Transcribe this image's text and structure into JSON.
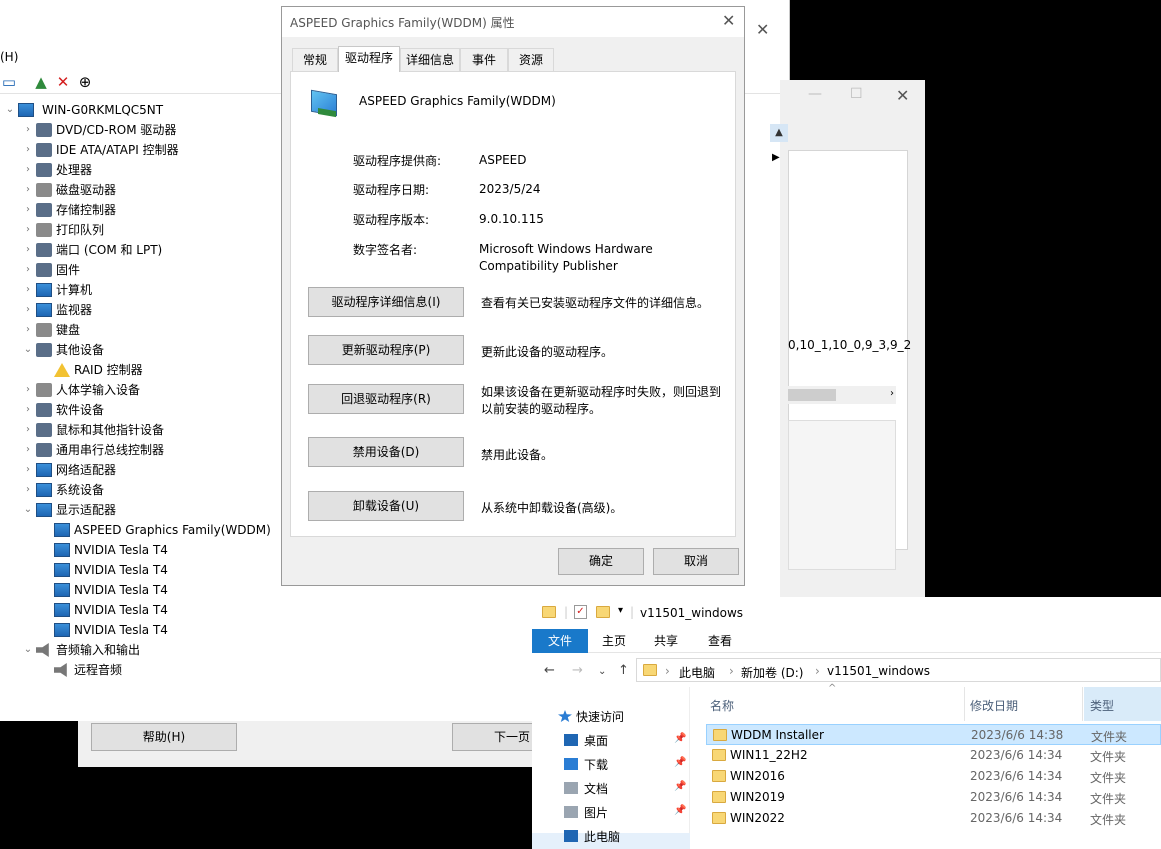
{
  "device_manager": {
    "menu_fragment": "(H)",
    "toolbar_icons": [
      "monitor-icon",
      "update-driver-icon",
      "uninstall-icon",
      "download-icon"
    ],
    "computer_name": "WIN-G0RKMLQC5NT",
    "tree": [
      {
        "label": "DVD/CD-ROM 驱动器",
        "icon": "disc-icon",
        "expand": "›"
      },
      {
        "label": "IDE ATA/ATAPI 控制器",
        "icon": "ide-icon",
        "expand": "›"
      },
      {
        "label": "处理器",
        "icon": "cpu-icon",
        "expand": "›"
      },
      {
        "label": "磁盘驱动器",
        "icon": "disk-icon",
        "expand": "›"
      },
      {
        "label": "存储控制器",
        "icon": "storage-icon",
        "expand": "›"
      },
      {
        "label": "打印队列",
        "icon": "printer-icon",
        "expand": "›"
      },
      {
        "label": "端口 (COM 和 LPT)",
        "icon": "port-icon",
        "expand": "›"
      },
      {
        "label": "固件",
        "icon": "firmware-icon",
        "expand": "›"
      },
      {
        "label": "计算机",
        "icon": "computer-icon",
        "expand": "›"
      },
      {
        "label": "监视器",
        "icon": "monitor-icon",
        "expand": "›"
      },
      {
        "label": "键盘",
        "icon": "keyboard-icon",
        "expand": "›"
      },
      {
        "label": "其他设备",
        "icon": "unknown-device-icon",
        "expand": "⌄"
      },
      {
        "label": "RAID 控制器",
        "icon": "warning-icon",
        "expand": "",
        "child": true
      },
      {
        "label": "人体学输入设备",
        "icon": "hid-icon",
        "expand": "›"
      },
      {
        "label": "软件设备",
        "icon": "software-icon",
        "expand": "›"
      },
      {
        "label": "鼠标和其他指针设备",
        "icon": "mouse-icon",
        "expand": "›"
      },
      {
        "label": "通用串行总线控制器",
        "icon": "usb-icon",
        "expand": "›"
      },
      {
        "label": "网络适配器",
        "icon": "network-icon",
        "expand": "›"
      },
      {
        "label": "系统设备",
        "icon": "system-icon",
        "expand": "›"
      },
      {
        "label": "显示适配器",
        "icon": "display-adapter-icon",
        "expand": "⌄"
      },
      {
        "label": "ASPEED Graphics Family(WDDM)",
        "icon": "display-adapter-icon",
        "expand": "",
        "child": true
      },
      {
        "label": "NVIDIA Tesla T4",
        "icon": "display-adapter-icon",
        "expand": "",
        "child": true
      },
      {
        "label": "NVIDIA Tesla T4",
        "icon": "display-adapter-icon",
        "expand": "",
        "child": true
      },
      {
        "label": "NVIDIA Tesla T4",
        "icon": "display-adapter-icon",
        "expand": "",
        "child": true
      },
      {
        "label": "NVIDIA Tesla T4",
        "icon": "display-adapter-icon",
        "expand": "",
        "child": true
      },
      {
        "label": "NVIDIA Tesla T4",
        "icon": "display-adapter-icon",
        "expand": "",
        "child": true
      },
      {
        "label": "音频输入和输出",
        "icon": "speaker-icon",
        "expand": "⌄"
      },
      {
        "label": "远程音频",
        "icon": "speaker-icon",
        "expand": "",
        "child": true
      }
    ],
    "help_button": "帮助(H)",
    "next_button": "下一页"
  },
  "back_window": {
    "truncated_text": "0,10_1,10_0,9_3,9_2"
  },
  "dialog": {
    "title": "ASPEED Graphics Family(WDDM) 属性",
    "tabs": [
      "常规",
      "驱动程序",
      "详细信息",
      "事件",
      "资源"
    ],
    "active_tab": 1,
    "device_name": "ASPEED Graphics Family(WDDM)",
    "info": [
      {
        "label": "驱动程序提供商:",
        "value": "ASPEED"
      },
      {
        "label": "驱动程序日期:",
        "value": "2023/5/24"
      },
      {
        "label": "驱动程序版本:",
        "value": "9.0.10.115"
      },
      {
        "label": "数字签名者:",
        "value": "Microsoft Windows Hardware Compatibility Publisher"
      }
    ],
    "actions": [
      {
        "button": "驱动程序详细信息(I)",
        "desc": "查看有关已安装驱动程序文件的详细信息。"
      },
      {
        "button": "更新驱动程序(P)",
        "desc": "更新此设备的驱动程序。"
      },
      {
        "button": "回退驱动程序(R)",
        "desc": "如果该设备在更新驱动程序时失败，则回退到以前安装的驱动程序。"
      },
      {
        "button": "禁用设备(D)",
        "desc": "禁用此设备。"
      },
      {
        "button": "卸载设备(U)",
        "desc": "从系统中卸载设备(高级)。"
      }
    ],
    "ok": "确定",
    "cancel": "取消"
  },
  "explorer": {
    "title": "v11501_windows",
    "ribbon": [
      "文件",
      "主页",
      "共享",
      "查看"
    ],
    "breadcrumb": [
      "此电脑",
      "新加卷 (D:)",
      "v11501_windows"
    ],
    "nav": [
      {
        "label": "快速访问",
        "icon": "star-icon",
        "pinned": false
      },
      {
        "label": "桌面",
        "icon": "desktop-icon",
        "pinned": true
      },
      {
        "label": "下载",
        "icon": "download-icon",
        "pinned": true
      },
      {
        "label": "文档",
        "icon": "document-icon",
        "pinned": true
      },
      {
        "label": "图片",
        "icon": "picture-icon",
        "pinned": true
      },
      {
        "label": "此电脑",
        "icon": "computer-icon",
        "pinned": false
      }
    ],
    "columns": {
      "name": "名称",
      "date": "修改日期",
      "type": "类型"
    },
    "files": [
      {
        "name": "WDDM Installer",
        "date": "2023/6/6 14:38",
        "type": "文件夹",
        "selected": true
      },
      {
        "name": "WIN11_22H2",
        "date": "2023/6/6 14:34",
        "type": "文件夹",
        "selected": false
      },
      {
        "name": "WIN2016",
        "date": "2023/6/6 14:34",
        "type": "文件夹",
        "selected": false
      },
      {
        "name": "WIN2019",
        "date": "2023/6/6 14:34",
        "type": "文件夹",
        "selected": false
      },
      {
        "name": "WIN2022",
        "date": "2023/6/6 14:34",
        "type": "文件夹",
        "selected": false
      }
    ]
  }
}
